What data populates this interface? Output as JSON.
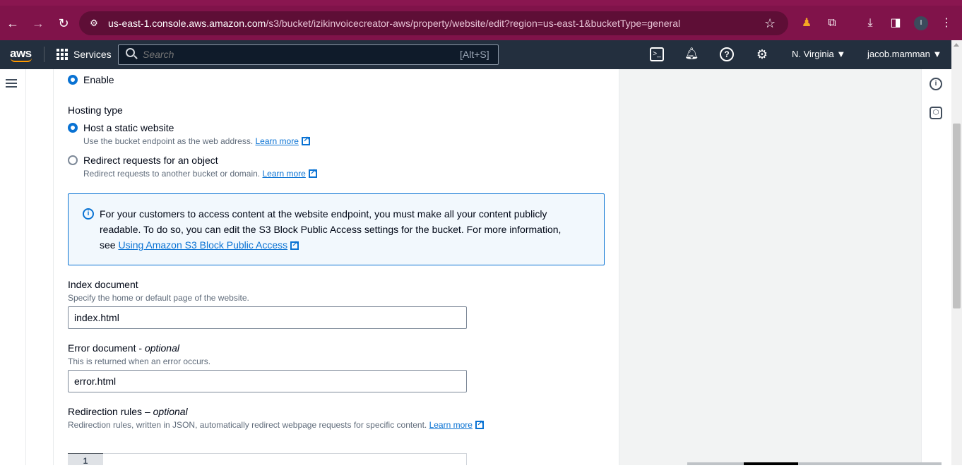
{
  "browser": {
    "url_host": "us-east-1.console.aws.amazon.com",
    "url_path": "/s3/bucket/izikinvoicecreator-aws/property/website/edit?region=us-east-1&bucketType=general",
    "profile_initial": "I"
  },
  "aws_nav": {
    "logo": "aws",
    "services_label": "Services",
    "search_placeholder": "Search",
    "search_shortcut": "[Alt+S]",
    "region": "N. Virginia ▼",
    "user": "jacob.mamman ▼"
  },
  "static_hosting": {
    "enable_label": "Enable",
    "hosting_type_label": "Hosting type",
    "options": [
      {
        "label": "Host a static website",
        "description": "Use the bucket endpoint as the web address.",
        "link": "Learn more",
        "selected": true
      },
      {
        "label": "Redirect requests for an object",
        "description": "Redirect requests to another bucket or domain.",
        "link": "Learn more",
        "selected": false
      }
    ]
  },
  "info_alert": {
    "line1": "For your customers to access content at the website endpoint, you must make all your content publicly",
    "line2": "readable. To do so, you can edit the S3 Block Public Access settings for the bucket. For more information,",
    "line3_prefix": "see",
    "link": "Using Amazon S3 Block Public Access"
  },
  "index_document": {
    "label": "Index document",
    "hint": "Specify the home or default page of the website.",
    "value": "index.html"
  },
  "error_document": {
    "label": "Error document -",
    "optional": "optional",
    "hint": "This is returned when an error occurs.",
    "value": "error.html"
  },
  "redirection_rules": {
    "label": "Redirection rules –",
    "optional": "optional",
    "hint": "Redirection rules, written in JSON, automatically redirect webpage requests for specific content.",
    "link": "Learn more",
    "line_number": "1"
  },
  "colors": {
    "browser_frame": "#80134a",
    "aws_nav": "#232f3e",
    "accent": "#0972d3",
    "info_bg": "#f2f8fd"
  }
}
